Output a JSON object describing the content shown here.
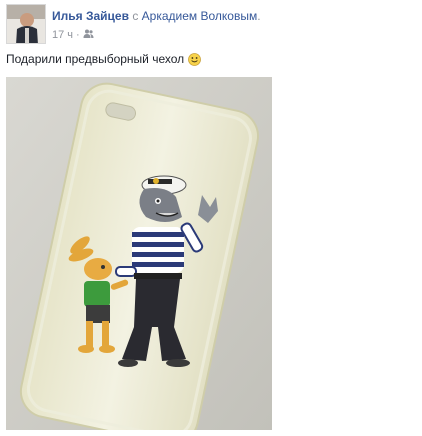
{
  "post": {
    "author": "Илья Зайцев",
    "with_word": "с",
    "tagged_person": "Аркадием Волковым",
    "period": ".",
    "timestamp": "17 ч",
    "separator": "·",
    "audience_icon": "friends-icon",
    "text": "Подарили предвыборный чехол",
    "emoji": "smile-emoji"
  },
  "colors": {
    "link": "#365899",
    "muted": "#90949c",
    "text": "#1d2129"
  }
}
